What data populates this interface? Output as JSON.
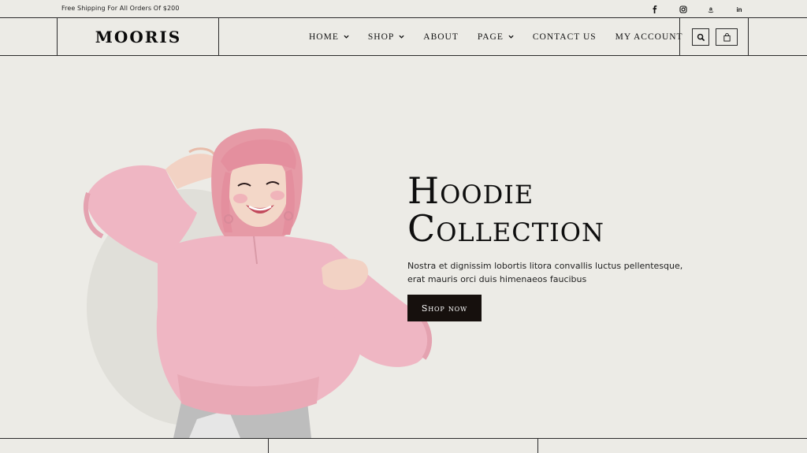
{
  "topbar": {
    "promo": "Free Shipping For All Orders Of $200",
    "social": [
      {
        "name": "facebook-icon",
        "glyph": "f"
      },
      {
        "name": "instagram-icon",
        "glyph": "ig"
      },
      {
        "name": "amazon-icon",
        "glyph": "a"
      },
      {
        "name": "linkedin-icon",
        "glyph": "in"
      }
    ]
  },
  "header": {
    "logo": "MOORIS",
    "nav": [
      {
        "label": "HOME",
        "has_dropdown": true
      },
      {
        "label": "SHOP",
        "has_dropdown": true
      },
      {
        "label": "ABOUT",
        "has_dropdown": false
      },
      {
        "label": "PAGE",
        "has_dropdown": true
      },
      {
        "label": "CONTACT US",
        "has_dropdown": false
      },
      {
        "label": "MY ACCOUNT",
        "has_dropdown": false
      }
    ],
    "icons": [
      "search-icon",
      "shopping-bag-icon"
    ]
  },
  "hero": {
    "title_line1": "Hoodie",
    "title_line2": "Collection",
    "description": "Nostra et dignissim lobortis litora convallis luctus pellentesque, erat mauris orci duis himenaeos faucibus",
    "button_label": "Shop now"
  },
  "colors": {
    "background": "#ecebe6",
    "button_bg": "#16100d",
    "hoodie_pink": "#efb6c3",
    "hair_pink": "#e69aa6"
  }
}
